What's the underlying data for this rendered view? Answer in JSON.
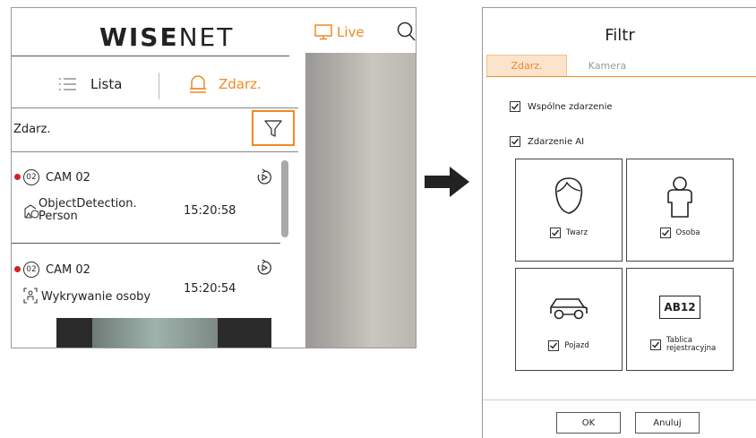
{
  "left": {
    "brand_bold": "WISE",
    "brand_thin": "NET",
    "live_label": "Live",
    "tab_list": "Lista",
    "tab_events": "Zdarz.",
    "filter_label": "Zdarz.",
    "events": [
      {
        "channel": "02",
        "camera": "CAM 02",
        "line1": "ObjectDetection.",
        "line2": "Person",
        "time": "15:20:58"
      },
      {
        "channel": "02",
        "camera": "CAM 02",
        "line1": "Wykrywanie osoby",
        "line2": "",
        "time": "15:20:54"
      }
    ]
  },
  "dialog": {
    "title": "Filtr",
    "tabs": [
      "Zdarz.",
      "Kamera"
    ],
    "common_event": "Wspólne zdarzenie",
    "ai_event": "Zdarzenie AI",
    "cards": [
      {
        "label": "Twarz",
        "icon": "face-icon"
      },
      {
        "label": "Osoba",
        "icon": "person-icon"
      },
      {
        "label": "Pojazd",
        "icon": "car-icon"
      },
      {
        "label": "Tablica rejestracyjna",
        "icon": "license-plate-icon",
        "plate_text": "AB12"
      }
    ],
    "ok": "OK",
    "cancel": "Anuluj"
  },
  "colors": {
    "accent": "#f08a24",
    "event_dot": "#d21f2a"
  }
}
